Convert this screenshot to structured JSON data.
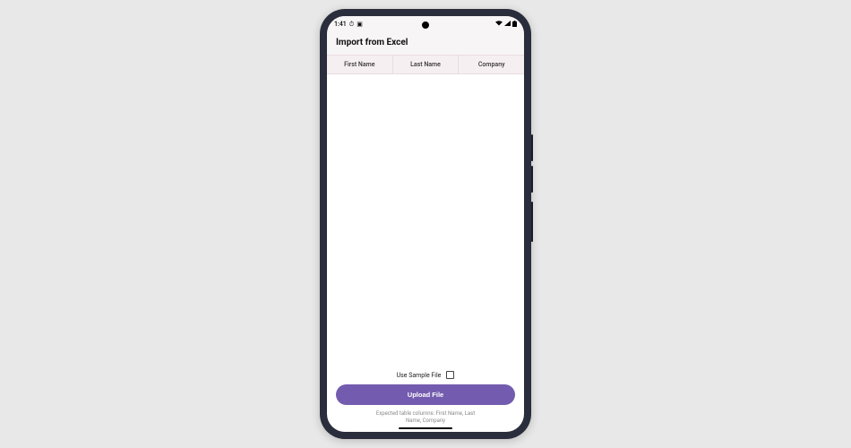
{
  "status_bar": {
    "time": "1:41",
    "wifi_icon": "▾",
    "signal_icon": "◢",
    "battery_icon": "▮"
  },
  "header": {
    "title": "Import from Excel"
  },
  "table": {
    "columns": [
      "First Name",
      "Last Name",
      "Company"
    ]
  },
  "footer": {
    "checkbox_label": "Use Sample File",
    "upload_button": "Upload File",
    "hint": "Expected table columns: First Name, Last Name, Company"
  },
  "colors": {
    "accent": "#735caf",
    "table_header_bg": "#f6eff2"
  }
}
